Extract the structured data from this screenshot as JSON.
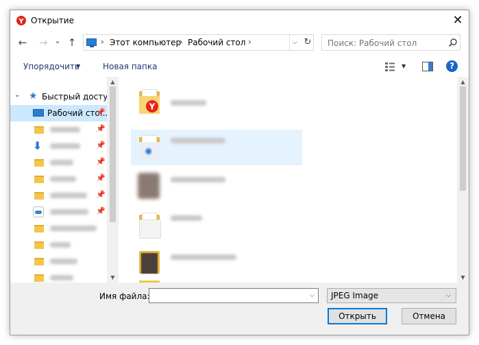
{
  "window": {
    "title": "Открытие"
  },
  "nav": {
    "back": "←",
    "forward": "→",
    "history": "⌄",
    "up": "↑"
  },
  "address": {
    "crumbs": [
      "Этот компьютер",
      "Рабочий стол"
    ],
    "separator": "›",
    "refresh": "↻"
  },
  "search": {
    "placeholder": "Поиск: Рабочий стол",
    "icon": "search-icon"
  },
  "toolbar": {
    "organize_label": "Упорядочить",
    "new_folder_label": "Новая папка",
    "help_label": "?"
  },
  "sidebar": {
    "quick_access_label": "Быстрый доступ",
    "desktop_label": "Рабочий сто..."
  },
  "bottom": {
    "filename_label": "Имя файла:",
    "filename_value": "",
    "filetype_value": "JPEG Image",
    "open_label": "Открыть",
    "cancel_label": "Отмена"
  },
  "colors": {
    "accent": "#0078d7",
    "selection": "#cce8ff",
    "folder": "#f4c44e",
    "help": "#1a66c7",
    "yandex_red": "#e3261b"
  }
}
